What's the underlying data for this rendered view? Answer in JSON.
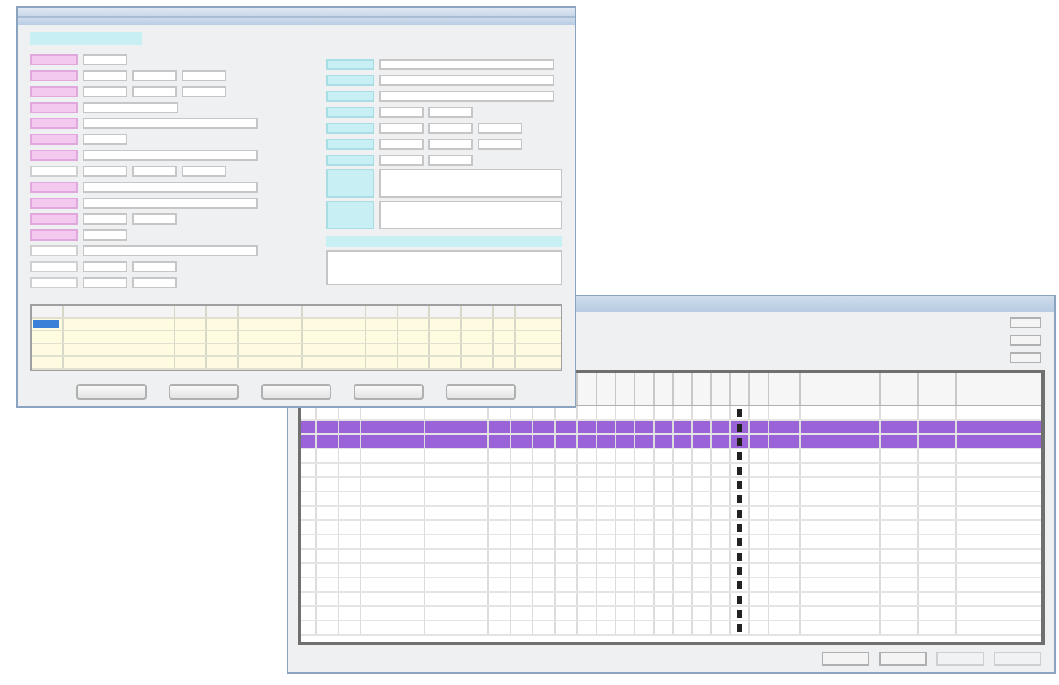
{
  "form_window": {
    "left_rows": [
      {
        "highlighted": true,
        "fields": [
          {
            "kind": "short"
          }
        ]
      },
      {
        "highlighted": true,
        "fields": [
          {
            "kind": "short"
          },
          {
            "kind": "short"
          },
          {
            "kind": "short"
          }
        ]
      },
      {
        "highlighted": true,
        "fields": [
          {
            "kind": "short"
          },
          {
            "kind": "short"
          },
          {
            "kind": "short"
          }
        ]
      },
      {
        "highlighted": true,
        "fields": [
          {
            "kind": "medium"
          }
        ]
      },
      {
        "highlighted": true,
        "fields": [
          {
            "kind": "wide"
          }
        ]
      },
      {
        "highlighted": true,
        "fields": [
          {
            "kind": "short"
          }
        ]
      },
      {
        "highlighted": true,
        "fields": [
          {
            "kind": "wide"
          }
        ]
      },
      {
        "highlighted": false,
        "fields": [
          {
            "kind": "short"
          },
          {
            "kind": "short"
          },
          {
            "kind": "short"
          }
        ]
      },
      {
        "highlighted": true,
        "fields": [
          {
            "kind": "wide"
          }
        ]
      },
      {
        "highlighted": true,
        "fields": [
          {
            "kind": "wide"
          }
        ]
      },
      {
        "highlighted": true,
        "fields": [
          {
            "kind": "short"
          },
          {
            "kind": "short"
          }
        ]
      },
      {
        "highlighted": true,
        "fields": [
          {
            "kind": "short"
          }
        ]
      },
      {
        "highlighted": false,
        "fields": [
          {
            "kind": "wide"
          }
        ]
      },
      {
        "highlighted": false,
        "fields": [
          {
            "kind": "short"
          },
          {
            "kind": "short"
          }
        ]
      },
      {
        "highlighted": false,
        "fields": [
          {
            "kind": "short"
          },
          {
            "kind": "short"
          }
        ]
      }
    ],
    "right_rows": [
      {
        "fields": [
          {
            "kind": "wide"
          }
        ]
      },
      {
        "fields": [
          {
            "kind": "wide"
          }
        ]
      },
      {
        "fields": [
          {
            "kind": "wide"
          }
        ]
      },
      {
        "fields": [
          {
            "kind": "short"
          },
          {
            "kind": "short"
          }
        ]
      },
      {
        "fields": [
          {
            "kind": "short"
          },
          {
            "kind": "short"
          },
          {
            "kind": "short"
          }
        ]
      },
      {
        "fields": [
          {
            "kind": "short"
          },
          {
            "kind": "short"
          },
          {
            "kind": "short"
          }
        ]
      },
      {
        "fields": [
          {
            "kind": "short"
          },
          {
            "kind": "short"
          }
        ]
      }
    ],
    "table_rows": [
      {
        "selected": true
      },
      {
        "selected": false
      },
      {
        "selected": false
      },
      {
        "selected": false
      }
    ],
    "buttons": [
      {
        "disabled": false
      },
      {
        "disabled": false
      },
      {
        "disabled": false
      },
      {
        "disabled": false
      },
      {
        "disabled": false
      }
    ]
  },
  "list_window": {
    "rows": [
      {
        "selected": false,
        "checked": true
      },
      {
        "selected": true,
        "checked": true
      },
      {
        "selected": true,
        "checked": true
      },
      {
        "selected": false,
        "checked": true
      },
      {
        "selected": false,
        "checked": true
      },
      {
        "selected": false,
        "checked": true
      },
      {
        "selected": false,
        "checked": true
      },
      {
        "selected": false,
        "checked": true
      },
      {
        "selected": false,
        "checked": true
      },
      {
        "selected": false,
        "checked": true
      },
      {
        "selected": false,
        "checked": true
      },
      {
        "selected": false,
        "checked": true
      },
      {
        "selected": false,
        "checked": true
      },
      {
        "selected": false,
        "checked": true
      },
      {
        "selected": false,
        "checked": true
      },
      {
        "selected": false,
        "checked": true
      }
    ],
    "side_buttons": [
      {
        "disabled": false
      },
      {
        "disabled": false
      },
      {
        "disabled": false
      }
    ],
    "footer_buttons": [
      {
        "disabled": false
      },
      {
        "disabled": false
      },
      {
        "disabled": true
      },
      {
        "disabled": true
      }
    ]
  }
}
